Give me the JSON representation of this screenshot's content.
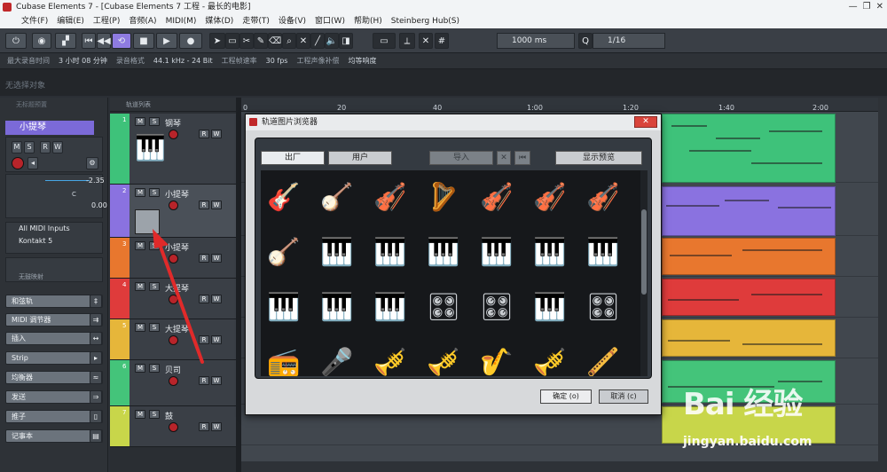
{
  "window": {
    "title": "Cubase Elements 7 - [Cubase Elements 7 工程 - 最长的电影]",
    "controls": [
      "—",
      "❐",
      "✕"
    ]
  },
  "menubar": [
    "文件(F)",
    "编辑(E)",
    "工程(P)",
    "音频(A)",
    "MIDI(M)",
    "媒体(D)",
    "走带(T)",
    "设备(V)",
    "窗口(W)",
    "帮助(H)",
    "Steinberg Hub(S)"
  ],
  "toolbar": {
    "nudge": "1000 ms",
    "quantize": "1/16"
  },
  "infobar": {
    "rec_time_label": "最大录音时间",
    "rec_time": "3 小时 08 分钟",
    "format_label": "录音格式",
    "format": "44.1 kHz - 24 Bit",
    "fps_label": "工程帧速率",
    "fps": "30 fps",
    "pan_label": "工程声像补偿",
    "pan": "均等响度"
  },
  "selection": {
    "none": "无选择对象"
  },
  "inspector": {
    "header": "无标题预置",
    "track_name": "小提琴",
    "volume": "-2.35",
    "pan_label": "C",
    "pan_value": "0.00",
    "midi_in": "All MIDI Inputs",
    "instrument": "Kontakt 5",
    "no_map": "无鼓映射",
    "sections": [
      "和弦轨",
      "MIDI 调节器",
      "插入",
      "Strip",
      "均衡器",
      "发送",
      "推子",
      "记事本"
    ]
  },
  "tracklist": {
    "header": "轨道列表",
    "tracks": [
      {
        "num": "1",
        "name": "钢琴",
        "color": "#3ec27a"
      },
      {
        "num": "2",
        "name": "小提琴",
        "color": "#8a72e0"
      },
      {
        "num": "3",
        "name": "小提琴",
        "color": "#e8772e"
      },
      {
        "num": "4",
        "name": "大提琴",
        "color": "#df3b3b"
      },
      {
        "num": "5",
        "name": "大提琴",
        "color": "#e6b63a"
      },
      {
        "num": "6",
        "name": "贝司",
        "color": "#44c47a"
      },
      {
        "num": "7",
        "name": "鼓",
        "color": "#c8d64a"
      }
    ]
  },
  "ruler": [
    "0",
    "20",
    "40",
    "1:00",
    "1:20",
    "1:40",
    "2:00"
  ],
  "dialog": {
    "title": "轨道图片浏览器",
    "tabs": {
      "factory": "出厂",
      "user": "用户",
      "import": "导入",
      "preview": "显示预览"
    },
    "instruments": [
      "🎸",
      "🪕",
      "🎻",
      "🪉",
      "🎻",
      "🎻",
      "🎻",
      "🪕",
      "🎹",
      "🎹",
      "🎹",
      "🎹",
      "🎹",
      "🎹",
      "🎹",
      "🎹",
      "🎹",
      "🎛",
      "🎛",
      "🎹",
      "🎛",
      "📻",
      "🎤",
      "🎺",
      "🎺",
      "🎷",
      "🎺",
      "🪈"
    ],
    "ok": "确定 (o)",
    "cancel": "取消 (c)"
  },
  "watermark": {
    "logo": "Bai 经验",
    "url": "jingyan.baidu.com"
  }
}
